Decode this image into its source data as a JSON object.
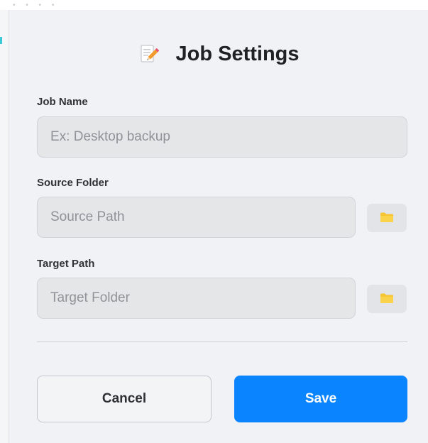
{
  "dialog": {
    "title": "Job Settings",
    "title_icon": "memo-pencil-icon"
  },
  "fields": {
    "job_name": {
      "label": "Job Name",
      "value": "",
      "placeholder": "Ex: Desktop backup"
    },
    "source_folder": {
      "label": "Source Folder",
      "value": "",
      "placeholder": "Source Path",
      "browse_icon": "folder-icon"
    },
    "target_path": {
      "label": "Target Path",
      "value": "",
      "placeholder": "Target Folder",
      "browse_icon": "folder-icon"
    }
  },
  "actions": {
    "cancel_label": "Cancel",
    "save_label": "Save"
  },
  "colors": {
    "accent": "#0a84ff",
    "dialog_bg": "#f1f2f5",
    "input_bg": "#e5e6e8",
    "folder_icon": "#f7c531"
  }
}
